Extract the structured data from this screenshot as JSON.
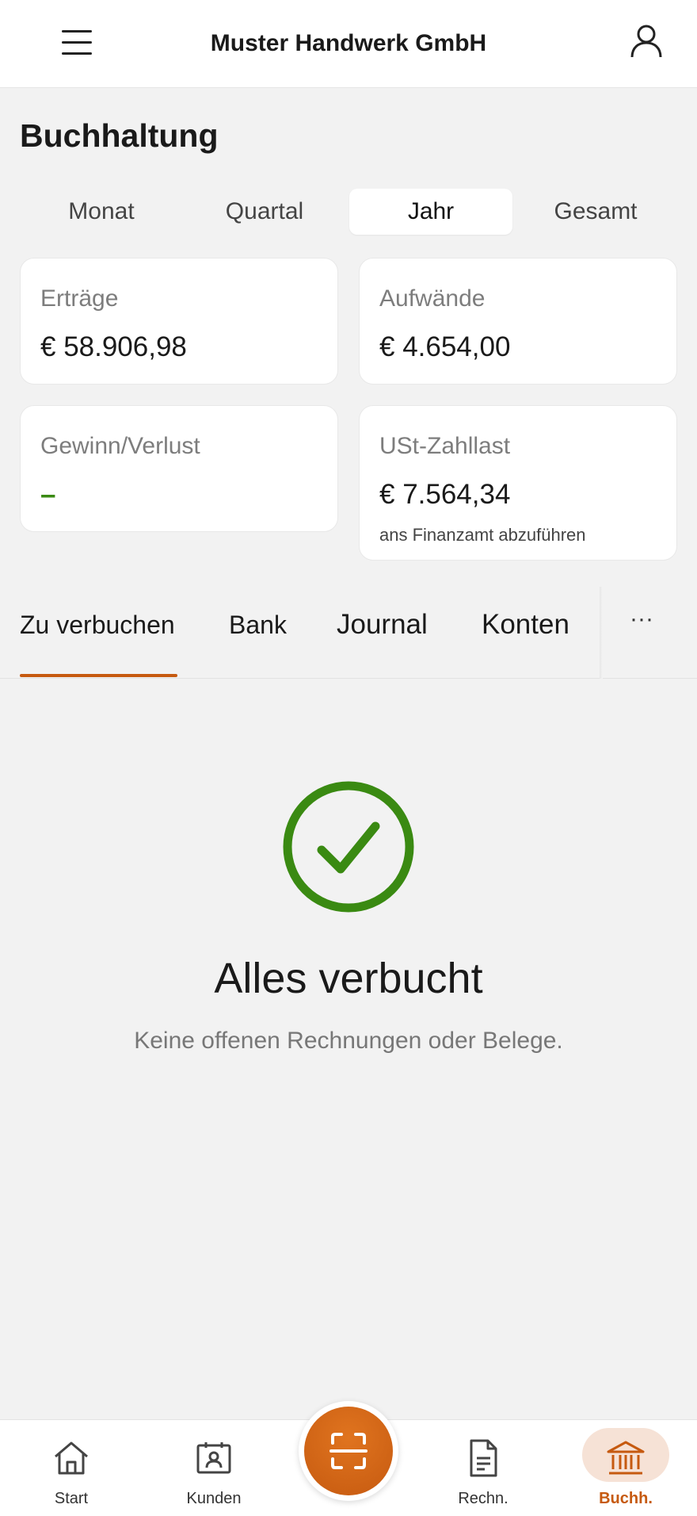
{
  "header": {
    "title": "Muster Handwerk GmbH"
  },
  "page": {
    "title": "Buchhaltung"
  },
  "period_tabs": [
    {
      "label": "Monat",
      "active": false
    },
    {
      "label": "Quartal",
      "active": false
    },
    {
      "label": "Jahr",
      "active": true
    },
    {
      "label": "Gesamt",
      "active": false
    }
  ],
  "kpis": {
    "ertraege": {
      "label": "Erträge",
      "value": "€ 58.906,98"
    },
    "aufwaende": {
      "label": "Aufwände",
      "value": "€ 4.654,00"
    },
    "gewinn": {
      "label": "Gewinn/Verlust",
      "value": "–"
    },
    "ust": {
      "label": "USt-Zahllast",
      "value": "€ 7.564,34",
      "note": "ans Finanzamt abzuführen"
    }
  },
  "content_tabs": [
    {
      "label": "Zu verbuchen",
      "active": true
    },
    {
      "label": "Bank",
      "active": false
    },
    {
      "label": "Journal",
      "active": false
    },
    {
      "label": "Konten",
      "active": false
    }
  ],
  "more_label": "···",
  "empty_state": {
    "title": "Alles verbucht",
    "subtitle": "Keine offenen Rechnungen oder Belege."
  },
  "bottom_nav": [
    {
      "label": "Start",
      "icon": "home-icon",
      "active": false
    },
    {
      "label": "Kunden",
      "icon": "contacts-icon",
      "active": false
    },
    {
      "label": "Rechn.",
      "icon": "document-icon",
      "active": false
    },
    {
      "label": "Buchh.",
      "icon": "bank-icon",
      "active": true
    }
  ],
  "colors": {
    "accent": "#c65a10",
    "success": "#3a8a12",
    "background": "#f2f2f2"
  }
}
